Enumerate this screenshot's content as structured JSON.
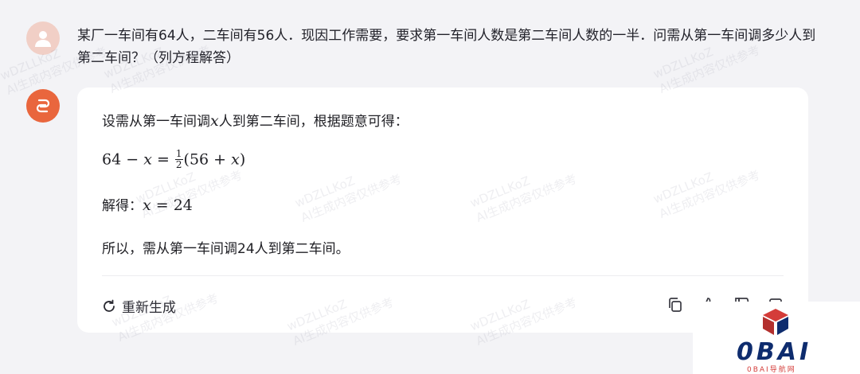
{
  "conversation": {
    "user_message": "某厂一车间有64人，二车间有56人．现因工作需要，要求第一车间人数是第二车间人数的一半．问需从第一车间调多少人到第二车间？（列方程解答）",
    "answer": {
      "intro_before_var": "设需从第一车间调",
      "intro_var": "x",
      "intro_after_var": "人到第二车间，根据题意可得：",
      "eq_left": "64 − ",
      "eq_var": "x",
      "eq_mid": " = ",
      "frac_num": "1",
      "frac_den": "2",
      "eq_paren_open": "(56 + ",
      "eq_var2": "x",
      "eq_paren_close": ")",
      "solve_label": "解得：",
      "solve_var": "x",
      "solve_eq": " = 24",
      "conclusion": "所以，需从第一车间调24人到第二车间。"
    },
    "actions": {
      "regenerate_label": "重新生成",
      "icons": [
        "copy-icon",
        "thumbs-up-icon",
        "thumbs-down-icon",
        "share-icon"
      ]
    }
  },
  "watermark": {
    "line1": "wDZLLKoZ",
    "line2": "AI生成内容仅供参考"
  },
  "logo": {
    "text": "0BAI",
    "subtitle": "0BAI导航网",
    "colors": {
      "red": "#d43c39",
      "blue": "#0e2c6e"
    }
  },
  "colors": {
    "user_avatar": "#f1cfc6",
    "bot_avatar": "#e9663d",
    "background": "#f3f3f6"
  }
}
